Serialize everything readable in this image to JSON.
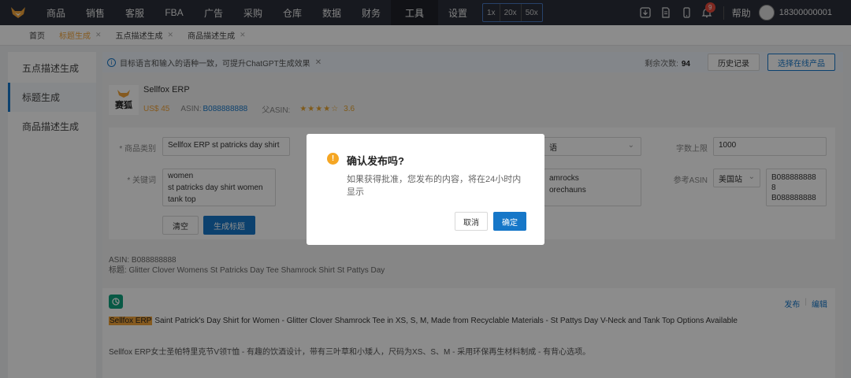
{
  "nav": {
    "items": [
      "商品",
      "销售",
      "客服",
      "FBA",
      "广告",
      "采购",
      "仓库",
      "数据",
      "财务",
      "工具",
      "设置"
    ],
    "active": "工具",
    "zoom": [
      "1x",
      "20x",
      "50x"
    ],
    "notification_count": "9",
    "help": "帮助",
    "user_phone": "18300000001"
  },
  "tabs": [
    {
      "label": "首页",
      "closable": false
    },
    {
      "label": "标题生成",
      "closable": true,
      "active": true
    },
    {
      "label": "五点描述生成",
      "closable": true
    },
    {
      "label": "商品描述生成",
      "closable": true
    }
  ],
  "sidebar": {
    "items": [
      {
        "label": "五点描述生成"
      },
      {
        "label": "标题生成",
        "active": true
      },
      {
        "label": "商品描述生成"
      }
    ]
  },
  "notice": {
    "text": "目标语言和输入的语种一致，可提升ChatGPT生成效果"
  },
  "toolbar": {
    "remaining_label": "剩余次数:",
    "remaining_count": "94",
    "history": "历史记录",
    "select_product": "选择在线产品"
  },
  "product": {
    "logo_text": "赛狐",
    "name": "Sellfox ERP",
    "price": "US$ 45",
    "asin_label": "ASIN:",
    "asin": "B088888888",
    "parent_asin_label": "父ASIN:",
    "rating": "3.6"
  },
  "form": {
    "category_label": "* 商品类别",
    "category_value": "Sellfox ERP st patricks day shirt",
    "language_value": "语",
    "word_limit_label": "字数上限",
    "word_limit_value": "1000",
    "keywords_label": "* 关键词",
    "keywords_line1": "women",
    "keywords_line2": "st patricks day shirt women",
    "keywords_line3": "tank top",
    "extra_line1": "amrocks",
    "extra_line2": "orechauns",
    "ref_asin_label": "参考ASIN",
    "ref_asin_site": "美国站",
    "ref_asin_line1": "B088888888",
    "ref_asin_line2": "8",
    "ref_asin_line3": "B088888888",
    "clear_btn": "清空",
    "generate_btn": "生成标题"
  },
  "result": {
    "asin_line": "ASIN:  B088888888",
    "title_line": "标题:  Glitter Clover Womens St Patricks Day Tee Shamrock Shirt St Pattys Day",
    "publish": "发布",
    "edit": "编辑",
    "highlight": "Sellfox ERP",
    "gen_title": "Saint Patrick's Day Shirt for Women - Glitter Clover Shamrock Tee in XS, S, M, Made from Recyclable Materials - St Pattys Day V-Neck and Tank Top Options Available",
    "gen_cn": "Sellfox ERP女士圣帕特里克节V领T恤 - 有趣的饮酒设计，带有三叶草和小矮人，尺码为XS、S、M - 采用环保再生材料制成 - 有背心选项。"
  },
  "modal": {
    "title": "确认发布吗?",
    "body": "如果获得批准，您发布的内容，将在24小时内显示",
    "cancel": "取消",
    "confirm": "确定"
  }
}
